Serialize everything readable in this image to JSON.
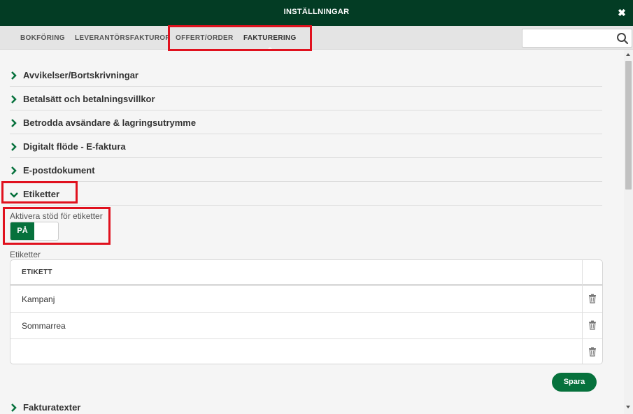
{
  "window": {
    "title": "INSTÄLLNINGAR",
    "close_icon": "close-icon"
  },
  "tabs": [
    {
      "label": "BOKFÖRING",
      "active": false
    },
    {
      "label": "LEVERANTÖRSFAKTUROR",
      "active": false
    },
    {
      "label": "OFFERT/ORDER",
      "active": false
    },
    {
      "label": "FAKTURERING",
      "active": true
    }
  ],
  "search": {
    "value": "",
    "placeholder": "",
    "icon": "search-icon"
  },
  "sections": [
    {
      "label": "Avvikelser/Bortskrivningar",
      "expanded": false
    },
    {
      "label": "Betalsätt och betalningsvillkor",
      "expanded": false
    },
    {
      "label": "Betrodda avsändare & lagringsutrymme",
      "expanded": false
    },
    {
      "label": "Digitalt flöde - E-faktura",
      "expanded": false
    },
    {
      "label": "E-postdokument",
      "expanded": false
    },
    {
      "label": "Etiketter",
      "expanded": true
    },
    {
      "label": "Fakturatexter",
      "expanded": false
    }
  ],
  "etiketter": {
    "toggle_label": "Aktivera stöd för etiketter",
    "toggle_state": "PÅ",
    "table_label": "Etiketter",
    "column_header": "ETIKETT",
    "rows": [
      "Kampanj",
      "Sommarrea",
      ""
    ],
    "save_label": "Spara"
  },
  "colors": {
    "header_bg": "#033c24",
    "accent": "#06713c",
    "highlight": "#e0111e"
  }
}
